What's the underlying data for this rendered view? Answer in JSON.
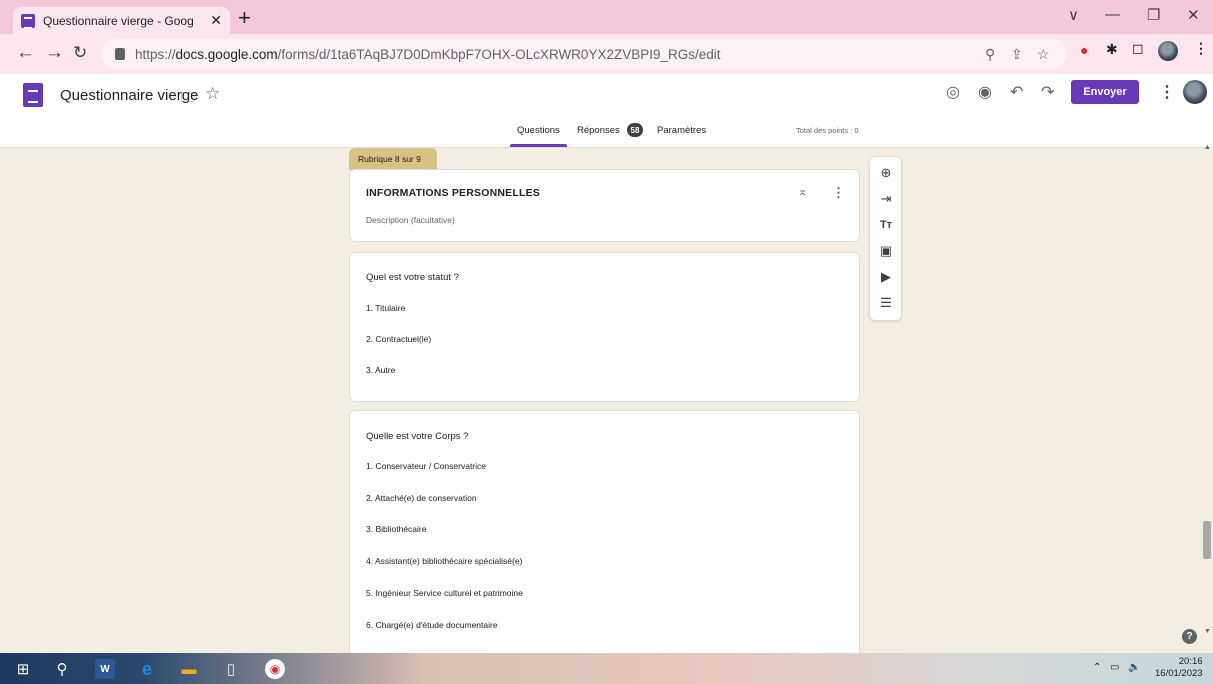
{
  "browser": {
    "tab_title": "Questionnaire vierge - Google Fo",
    "tab_close": "✕",
    "new_tab": "+",
    "url_prefix": "https://",
    "url_domain": "docs.google.com",
    "url_path": "/forms/d/1ta6TAqBJ7D0DmKbpF7OHX-OLcXRWR0YX2ZVBPI9_RGs/edit",
    "window_controls": [
      "∨",
      "—",
      "❐",
      "✕"
    ]
  },
  "form_header": {
    "title": "Questionnaire vierge",
    "send_label": "Envoyer",
    "tabs": [
      {
        "label": "Questions"
      },
      {
        "label": "Réponses"
      },
      {
        "label": "Paramètres"
      }
    ],
    "responses_count": "58",
    "total_points": "Total des points : 0"
  },
  "section": {
    "tag": "Rubrique 8 sur 9",
    "title": "INFORMATIONS PERSONNELLES",
    "description": "Description (facultative)"
  },
  "questions": [
    {
      "title": "Quel est votre statut ?",
      "options": [
        "1.  Titulaire",
        "2.  Contractuel(le)",
        "3.  Autre"
      ]
    },
    {
      "title": "Quelle est votre Corps ?",
      "options": [
        "1.  Conservateur / Conservatrice",
        "2.  Attaché(e) de conservation",
        "3.  Bibliothécaire",
        "4.  Assistant(e) bibliothécaire spécialisé(e)",
        "5.  Ingénieur Service culturel et patrimoine",
        "6.  Chargé(e) d'étude documentaire"
      ]
    }
  ],
  "side_toolbar": [
    "add-question",
    "import-questions",
    "add-title",
    "add-image",
    "add-video",
    "add-section"
  ],
  "taskbar": {
    "time": "20:16",
    "date": "16/01/2023"
  },
  "colors": {
    "form_accent": "#673ab7",
    "section_tag": "#d7c283",
    "background": "#f3eee1",
    "chrome_tab": "#f3c8dc"
  }
}
